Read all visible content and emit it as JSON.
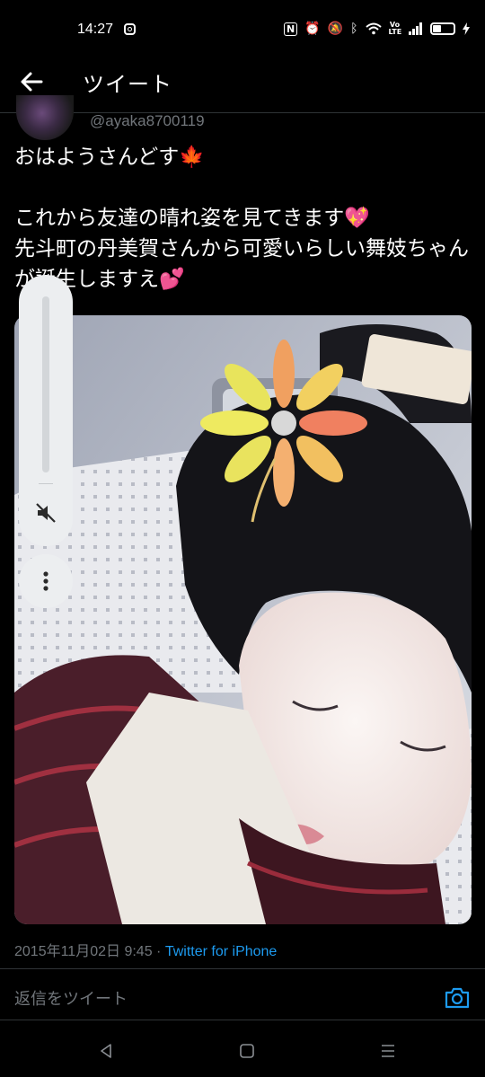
{
  "status_bar": {
    "time": "14:27",
    "icons": [
      "instagram-icon",
      "nfc-icon",
      "alarm-icon",
      "mute-icon",
      "bluetooth-icon",
      "wifi-icon",
      "volte-icon",
      "signal-icon",
      "battery-icon",
      "charging-icon"
    ],
    "volte_label": "Vo LTE"
  },
  "header": {
    "title": "ツイート",
    "back_icon": "arrow-left-icon"
  },
  "author": {
    "handle": "@ayaka8700119"
  },
  "tweet": {
    "text": "おはようさんどす🍁\n\nこれから友達の晴れ姿を見てきます💖\n先斗町の丹美賀さんから可愛いらしい舞妓ちゃんが誕生しますえ💕",
    "timestamp": "2015年11月02日 9:45",
    "separator": "·",
    "source": "Twitter for iPhone"
  },
  "volume_overlay": {
    "icons": [
      "volume-mute-icon",
      "more-vertical-icon"
    ]
  },
  "reply": {
    "placeholder": "返信をツイート",
    "camera_icon": "camera-icon"
  },
  "colors": {
    "background": "#000000",
    "accent": "#1d9bf0",
    "muted": "#71767b",
    "divider": "#2f3336"
  },
  "nav_bar": {
    "icons": [
      "nav-back-triangle-icon",
      "nav-home-square-icon",
      "nav-menu-lines-icon"
    ]
  }
}
